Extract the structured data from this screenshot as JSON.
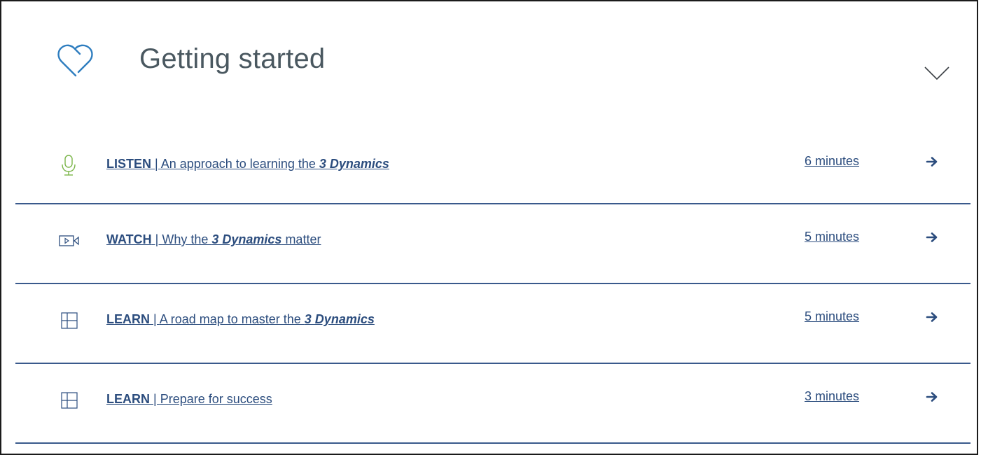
{
  "colors": {
    "accent_blue": "#2c4d7e",
    "divider": "#3a5a8c",
    "heart": "#2e7dbf",
    "mic_green": "#7bb54a",
    "title_gray": "#4a5860"
  },
  "header": {
    "title": "Getting started",
    "icon": "heart-outline-icon",
    "toggle_icon": "chevron-down-icon"
  },
  "items": [
    {
      "icon": "microphone-icon",
      "verb": "LISTEN",
      "separator": " | ",
      "text_before": "An approach to learning the ",
      "emphasis": "3 Dynamics",
      "text_after": "",
      "duration": "6 minutes"
    },
    {
      "icon": "video-camera-icon",
      "verb": "WATCH",
      "separator": " | ",
      "text_before": "Why the ",
      "emphasis": "3 Dynamics",
      "text_after": " matter",
      "duration": "5 minutes"
    },
    {
      "icon": "layout-grid-icon",
      "verb": "LEARN",
      "separator": " | ",
      "text_before": "A road map to master the ",
      "emphasis": "3 Dynamics",
      "text_after": "",
      "duration": "5 minutes"
    },
    {
      "icon": "layout-grid-icon",
      "verb": "LEARN",
      "separator": " | ",
      "text_before": "Prepare for success",
      "emphasis": "",
      "text_after": "",
      "duration": "3 minutes"
    }
  ]
}
